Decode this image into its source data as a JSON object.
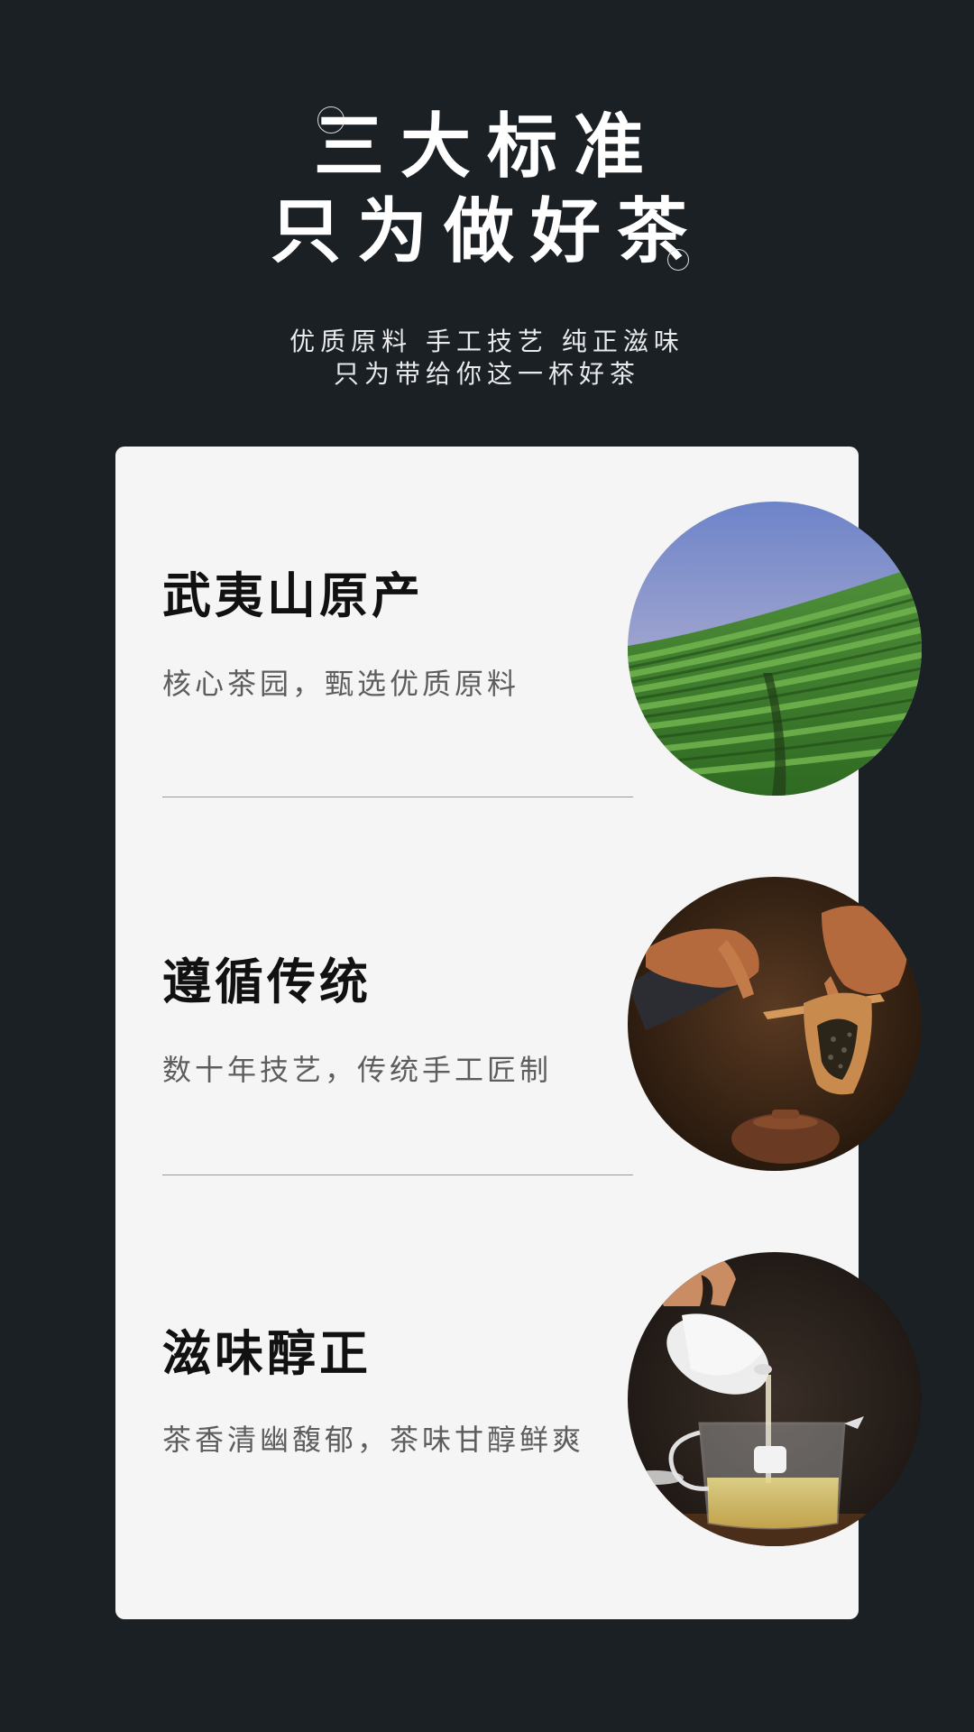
{
  "header": {
    "title_line1": "三大标准",
    "title_line2": "只为做好茶",
    "subtitle_line1": "优质原料 手工技艺 纯正滋味",
    "subtitle_line2": "只为带给你这一杯好茶"
  },
  "features": [
    {
      "title": "武夷山原产",
      "description": "核心茶园，甄选优质原料",
      "image": "tea-plantation-photo"
    },
    {
      "title": "遵循传统",
      "description": "数十年技艺，传统手工匠制",
      "image": "tea-crafting-hands-photo"
    },
    {
      "title": "滋味醇正",
      "description": "茶香清幽馥郁，茶味甘醇鲜爽",
      "image": "tea-pouring-photo"
    }
  ],
  "colors": {
    "background": "#1b2025",
    "card": "#f5f5f5",
    "title_text": "#111111",
    "desc_text": "#5d5d5d"
  }
}
